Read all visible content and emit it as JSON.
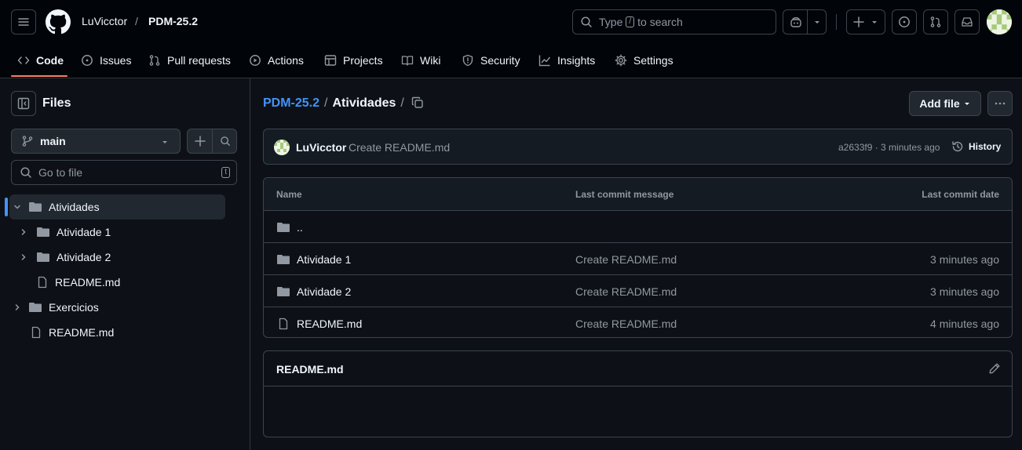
{
  "header": {
    "owner": "LuVicctor",
    "separator": "/",
    "repo": "PDM-25.2",
    "search_text_pre": "Type",
    "search_key": "/",
    "search_text_post": "to search"
  },
  "tabs": [
    {
      "label": "Code",
      "icon": "code-icon"
    },
    {
      "label": "Issues",
      "icon": "issue-icon"
    },
    {
      "label": "Pull requests",
      "icon": "pull-request-icon"
    },
    {
      "label": "Actions",
      "icon": "play-icon"
    },
    {
      "label": "Projects",
      "icon": "table-icon"
    },
    {
      "label": "Wiki",
      "icon": "book-icon"
    },
    {
      "label": "Security",
      "icon": "shield-icon"
    },
    {
      "label": "Insights",
      "icon": "graph-icon"
    },
    {
      "label": "Settings",
      "icon": "gear-icon"
    }
  ],
  "sidebar": {
    "title": "Files",
    "branch": "main",
    "goto_placeholder": "Go to file",
    "goto_key": "t",
    "tree": [
      {
        "label": "Atividades",
        "type": "folder",
        "expanded": true,
        "selected": true
      },
      {
        "label": "Atividade 1",
        "type": "folder"
      },
      {
        "label": "Atividade 2",
        "type": "folder"
      },
      {
        "label": "README.md",
        "type": "file"
      },
      {
        "label": "Exercicios",
        "type": "folder"
      },
      {
        "label": "README.md",
        "type": "file"
      }
    ]
  },
  "main": {
    "path_repo": "PDM-25.2",
    "path_sep1": "/",
    "path_folder": "Atividades",
    "path_sep2": "/",
    "add_file_label": "Add file",
    "commit": {
      "author": "LuVicctor",
      "message": "Create README.md",
      "meta": "a2633f9 · 3 minutes ago",
      "history_label": "History"
    },
    "table": {
      "headers": [
        "Name",
        "Last commit message",
        "Last commit date"
      ],
      "rows": [
        {
          "name": "..",
          "type": "folder",
          "message": "",
          "date": ""
        },
        {
          "name": "Atividade 1",
          "type": "folder",
          "message": "Create README.md",
          "date": "3 minutes ago"
        },
        {
          "name": "Atividade 2",
          "type": "folder",
          "message": "Create README.md",
          "date": "3 minutes ago"
        },
        {
          "name": "README.md",
          "type": "file",
          "message": "Create README.md",
          "date": "4 minutes ago"
        }
      ]
    },
    "readme_title": "README.md"
  },
  "colors": {
    "background": "#0d1117",
    "header_bg": "#010409",
    "border": "#3d444d",
    "accent_link": "#4493f8",
    "tab_underline": "#f78166",
    "muted_text": "#9198a1"
  }
}
